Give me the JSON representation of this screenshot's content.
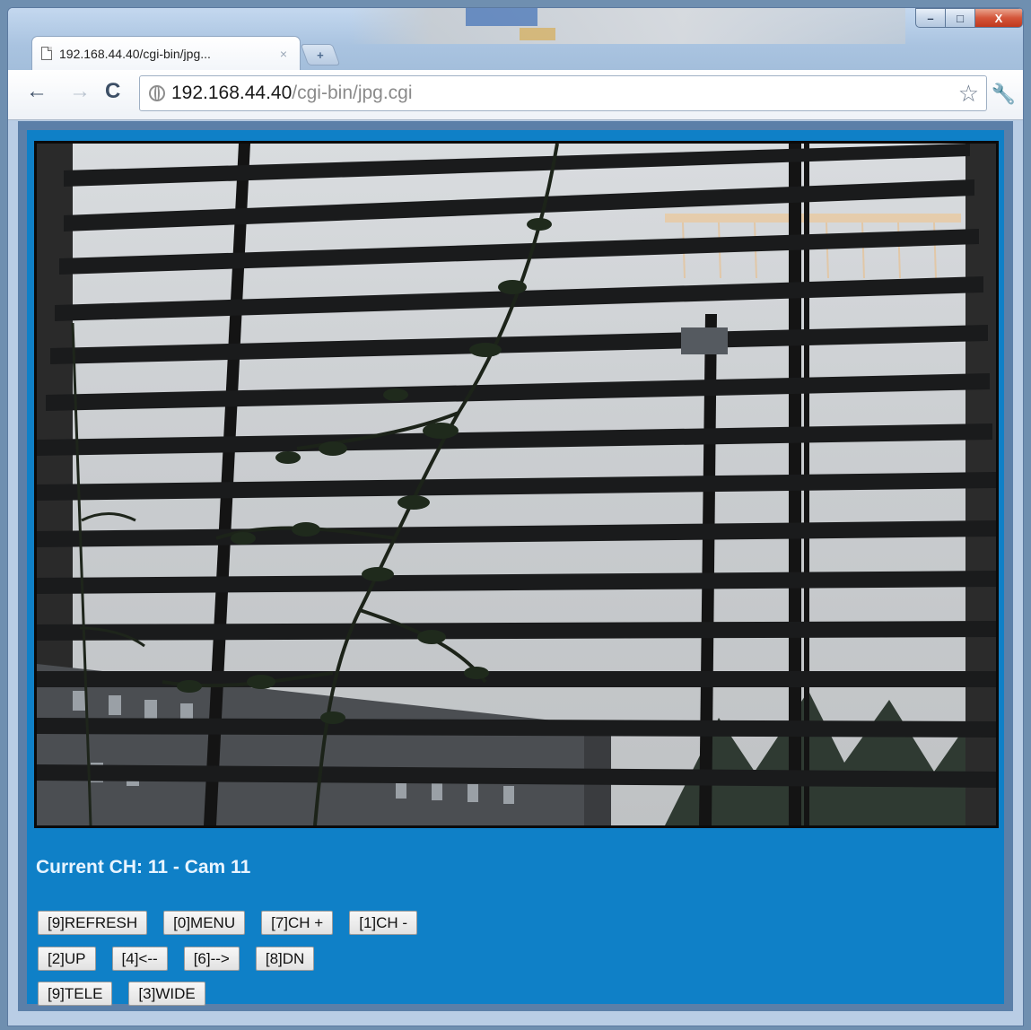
{
  "browser": {
    "tab_title": "192.168.44.40/cgi-bin/jpg...",
    "tab_close": "×",
    "new_tab": "+",
    "url_host": "192.168.44.40",
    "url_path": "/cgi-bin/jpg.cgi",
    "back_glyph": "←",
    "forward_glyph": "→",
    "reload_glyph": "C",
    "star_glyph": "☆",
    "wrench_glyph": "🔧",
    "window_buttons": {
      "minimize": "–",
      "maximize": "□",
      "close": "X"
    }
  },
  "page": {
    "current_channel": "Current CH: 11 - Cam 11",
    "buttons_row1": [
      "[9]REFRESH",
      "[0]MENU",
      "[7]CH +",
      "[1]CH -"
    ],
    "buttons_row2": [
      "[2]UP",
      "[4]<--",
      "[6]-->",
      "[8]DN"
    ],
    "buttons_row3": [
      "[9]TELE",
      "[3]WIDE"
    ]
  },
  "colors": {
    "page_background": "#0f80c7",
    "channel_text": "#e8f4ff"
  },
  "icons": [
    "page-icon",
    "back-icon",
    "forward-icon",
    "reload-icon",
    "globe-icon",
    "star-icon",
    "wrench-icon"
  ]
}
